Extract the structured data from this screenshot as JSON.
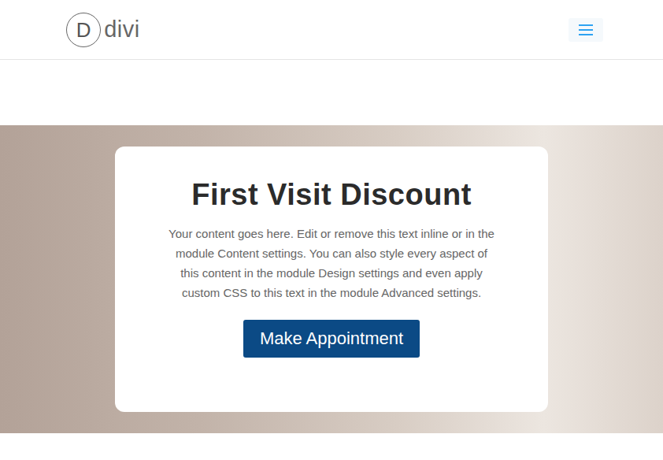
{
  "header": {
    "logo": {
      "mark": "D",
      "text": "divi"
    }
  },
  "hero": {
    "title": "First Visit Discount",
    "body": "Your content goes here. Edit or remove this text inline or in the module Content settings. You can also style every aspect of this content in the module Design settings and even apply custom CSS to this text in the module Advanced settings.",
    "button": "Make Appointment"
  }
}
